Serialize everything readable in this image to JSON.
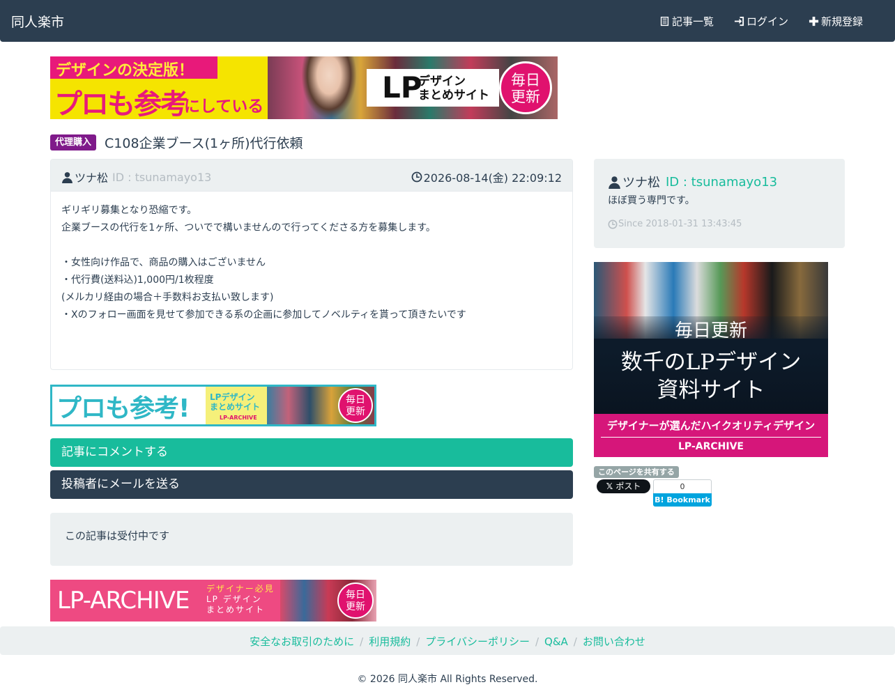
{
  "navbar": {
    "brand": "同人楽市",
    "items": [
      {
        "label": "記事一覧",
        "icon": "list-icon"
      },
      {
        "label": "ログイン",
        "icon": "login-icon"
      },
      {
        "label": "新規登録",
        "icon": "plus-icon"
      }
    ]
  },
  "banners": {
    "top": {
      "catch": "デザインの決定版！",
      "main": "プロも参考",
      "sub": "にしている",
      "lp": "LP",
      "lp_text_1": "デザイン",
      "lp_text_2": "まとめサイト",
      "circle_1": "毎日",
      "circle_2": "更新"
    },
    "middle": {
      "main": "プロも参考!",
      "text_1": "LPデザイン",
      "text_2": "まとめサイト",
      "small": "LP-ARCHIVE",
      "circle_1": "毎日",
      "circle_2": "更新"
    },
    "bottom": {
      "main": "LP-ARCHIVE",
      "text_1": "デザイナー必見",
      "text_2": "LP デザイン",
      "text_3": "まとめサイト",
      "circle_1": "毎日",
      "circle_2": "更新"
    },
    "side": {
      "line_1": "毎日更新",
      "line_2": "数千のLPデザイン",
      "line_3": "資料サイト",
      "line_4": "デザイナーが選んだハイクオリティデザイン",
      "line_5": "LP-ARCHIVE"
    }
  },
  "post": {
    "category": "代理購入",
    "title": "C108企業ブース(1ヶ所)代行依頼",
    "author_name": "ツナ松",
    "author_id": "ID : tsunamayo13",
    "datetime": "2026-08-14(金) 22:09:12",
    "body": [
      "ギリギリ募集となり恐縮です。",
      "企業ブースの代行を1ヶ所、ついでで構いませんので行ってくださる方を募集します。",
      "",
      "・女性向け作品で、商品の購入はございません",
      "・代行費(送料込)1,000円/1枚程度",
      "(メルカリ経由の場合＋手数料お支払い致します)",
      "・Xのフォロー画面を見せて参加できる系の企画に参加してノベルティを貰って頂きたいです"
    ]
  },
  "actions": {
    "comment": "記事にコメントする",
    "mail": "投稿者にメールを送る"
  },
  "status": "この記事は受付中です",
  "profile": {
    "name": "ツナ松",
    "id": "ID : tsunamayo13",
    "bio": "ほぼ買う専門です。",
    "since": "Since 2018-01-31 13:43:45"
  },
  "share": {
    "label": "このページを共有する",
    "x_post": "ポスト",
    "hatena_count": "0",
    "hatena_label": "B! Bookmark"
  },
  "footer": {
    "links": [
      "安全なお取引のために",
      "利用規約",
      "プライバシーポリシー",
      "Q&A",
      "お問い合わせ"
    ],
    "copyright": "© 2026 同人楽市 All Rights Reserved."
  },
  "colors": {
    "navbar": "#2c3e50",
    "accent": "#18bc9c",
    "category_badge": "#7f1a8a",
    "well": "#ecf0f1"
  }
}
